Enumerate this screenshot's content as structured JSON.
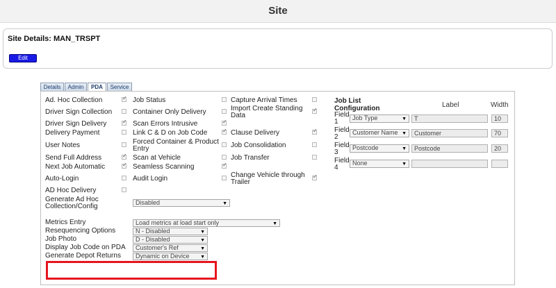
{
  "header": {
    "title": "Site"
  },
  "details": {
    "title": "Site Details: MAN_TRSPT",
    "edit_label": "Edit"
  },
  "tabs": [
    {
      "label": "Details",
      "active": false
    },
    {
      "label": "Admin",
      "active": false
    },
    {
      "label": "PDA",
      "active": true
    },
    {
      "label": "Service",
      "active": false
    }
  ],
  "options_col1": [
    {
      "label": "Ad. Hoc Collection",
      "checked": true
    },
    {
      "label": "Driver Sign Collection",
      "checked": false
    },
    {
      "label": "Driver Sign Delivery",
      "checked": true
    },
    {
      "label": "Delivery Payment",
      "checked": false
    },
    {
      "label": "User Notes",
      "checked": false
    },
    {
      "label": "Send Full Address",
      "checked": true
    },
    {
      "label": "Next Job Automatic",
      "checked": true
    },
    {
      "label": "Auto-Login",
      "checked": false
    },
    {
      "label": "AD Hoc Delivery",
      "checked": false
    }
  ],
  "options_col2": [
    {
      "label": "Job Status",
      "checked": false
    },
    {
      "label": "Container Only Delivery",
      "checked": false
    },
    {
      "label": "Scan Errors Intrusive",
      "checked": true
    },
    {
      "label": "Link C & D on Job Code",
      "checked": true
    },
    {
      "label": "Forced Container & Product Entry",
      "checked": false
    },
    {
      "label": "Scan at Vehicle",
      "checked": false
    },
    {
      "label": "Seamless Scanning",
      "checked": true
    },
    {
      "label": "Audit Login",
      "checked": false
    }
  ],
  "options_col3": [
    {
      "label": "Capture Arrival Times",
      "checked": false
    },
    {
      "label": "Import Create Standing Data",
      "checked": true
    },
    {
      "label": "Clause Delivery",
      "checked": true
    },
    {
      "label": "Job Consolidation",
      "checked": false
    },
    {
      "label": "Job Transfer",
      "checked": false
    },
    {
      "label": "Change Vehicle through Trailer",
      "checked": true
    }
  ],
  "generate_adhoc": {
    "label": "Generate Ad Hoc Collection/Config",
    "value": "Disabled"
  },
  "dropdowns": [
    {
      "label": "Metrics Entry",
      "value": "Load metrics at load start only"
    },
    {
      "label": "Resequencing Options",
      "value": "N - Disabled"
    },
    {
      "label": "Job Photo",
      "value": "D - Disabled"
    },
    {
      "label": "Display Job Code on PDA",
      "value": "Customer's Ref"
    },
    {
      "label": "Generate Depot Returns",
      "value": "Dynamic on Device"
    }
  ],
  "job_list": {
    "title_line1": "Job List",
    "title_line2": "Configuration",
    "label_header": "Label",
    "width_header": "Width",
    "field_word": "Field",
    "fields": [
      {
        "num": "1",
        "type": "Job Type",
        "label": "T",
        "width": "10"
      },
      {
        "num": "2",
        "type": "Customer Name",
        "label": "Customer",
        "width": "70"
      },
      {
        "num": "3",
        "type": "Postcode",
        "label": "Postcode",
        "width": "20"
      },
      {
        "num": "4",
        "type": "None",
        "label": "",
        "width": ""
      }
    ]
  },
  "colors": {
    "highlight": "#e6141e",
    "edit_button": "#1a1ae6"
  }
}
